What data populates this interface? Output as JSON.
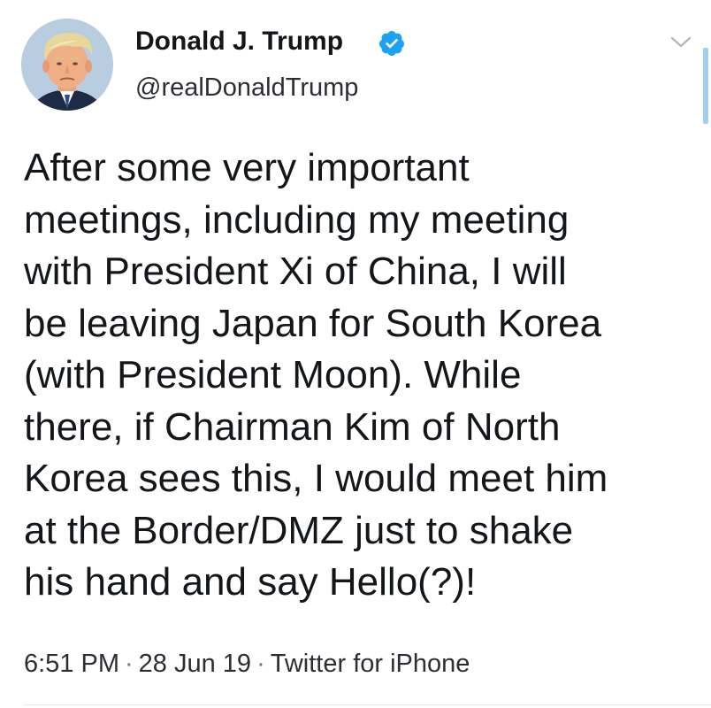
{
  "author": {
    "display_name": "Donald J. Trump",
    "handle": "@realDonaldTrump",
    "verified": true,
    "verified_color": "#1da1f2",
    "avatar_icon": "profile-photo"
  },
  "tweet": {
    "lines": [
      "After some very important",
      "meetings, including my meeting",
      "with President Xi of China, I will",
      "be leaving Japan for South Korea",
      "(with President Moon). While",
      "there, if Chairman Kim of North",
      "Korea sees this, I would meet him",
      "at the Border/DMZ just to shake",
      "his hand and say Hello(?)!"
    ]
  },
  "meta": {
    "time": "6:51 PM",
    "date": "28 Jun 19",
    "source": "Twitter for iPhone",
    "separator": "·"
  },
  "icons": {
    "verified": "verified-badge-icon",
    "menu": "chevron-down-icon"
  }
}
